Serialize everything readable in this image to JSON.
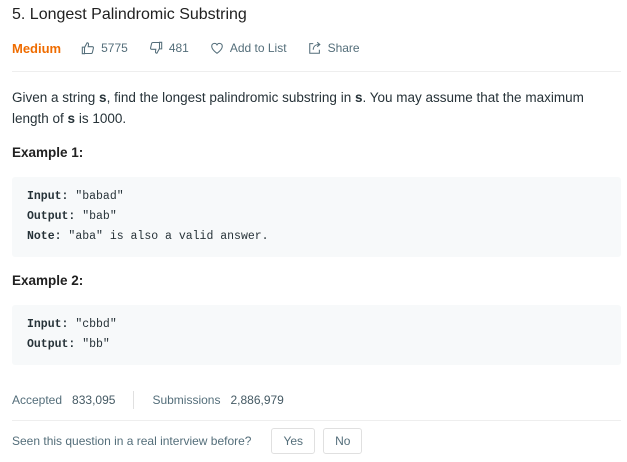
{
  "problem": {
    "title": "5. Longest Palindromic Substring",
    "difficulty": "Medium",
    "likes": "5775",
    "dislikes": "481",
    "add_to_list_label": "Add to List",
    "share_label": "Share"
  },
  "description": {
    "part1": "Given a string ",
    "var1": "s",
    "part2": ", find the longest palindromic substring in ",
    "var2": "s",
    "part3": ". You may assume that the maximum length of ",
    "var3": "s",
    "part4": " is 1000."
  },
  "examples": [
    {
      "title": "Example 1:",
      "input_key": "Input:",
      "input_val": " \"babad\"",
      "output_key": "Output:",
      "output_val": " \"bab\"",
      "note_key": "Note:",
      "note_val": " \"aba\" is also a valid answer."
    },
    {
      "title": "Example 2:",
      "input_key": "Input:",
      "input_val": " \"cbbd\"",
      "output_key": "Output:",
      "output_val": " \"bb\""
    }
  ],
  "stats": {
    "accepted_label": "Accepted",
    "accepted_value": "833,095",
    "submissions_label": "Submissions",
    "submissions_value": "2,886,979"
  },
  "interview": {
    "question": "Seen this question in a real interview before?",
    "yes_label": "Yes",
    "no_label": "No"
  },
  "icons": {
    "like": "thumbs-up-icon",
    "dislike": "thumbs-down-icon",
    "add_to_list": "heart-icon",
    "share": "share-icon"
  },
  "colors": {
    "difficulty_medium": "#ef6c00",
    "code_background": "#f7f9fa"
  }
}
